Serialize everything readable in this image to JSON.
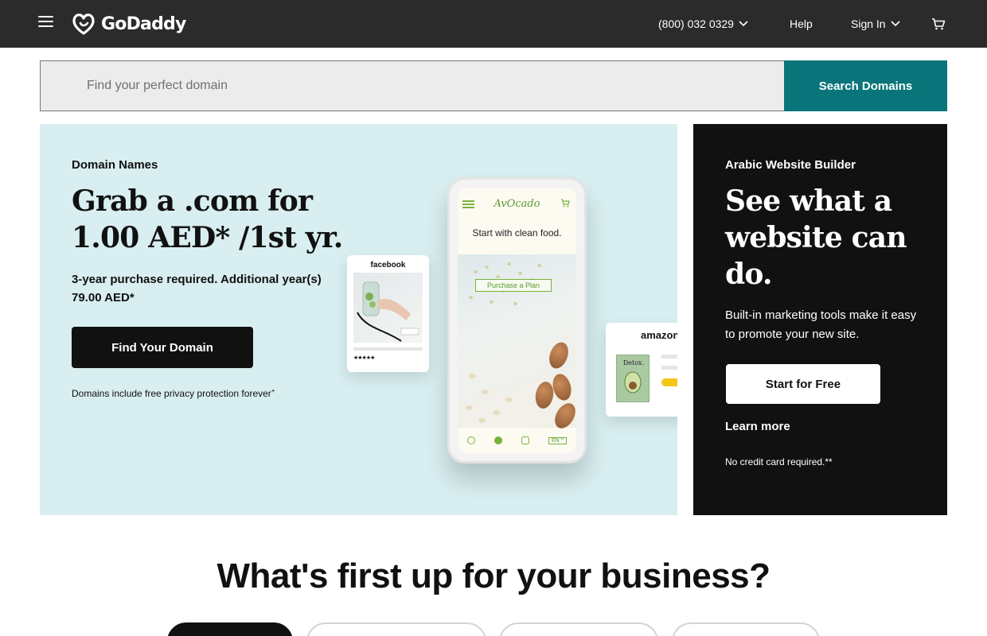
{
  "header": {
    "brand": "GoDaddy",
    "phone": "(800) 032 0329",
    "help": "Help",
    "sign_in": "Sign In"
  },
  "search": {
    "placeholder": "Find your perfect domain",
    "button": "Search Domains"
  },
  "hero": {
    "eyebrow": "Domain Names",
    "title": "Grab a .com for 1.00 AED* /1st yr.",
    "subtitle": "3-year purchase required. Additional year(s) 79.00 AED*",
    "button": "Find Your Domain",
    "note": "Domains include free privacy protection forever",
    "note_mark": "+",
    "mockup": {
      "facebook_label": "facebook",
      "phone_brand": "AvOcado",
      "phone_headline": "Start with clean food.",
      "phone_cta": "Purchase a Plan",
      "phone_lang": "EN ^",
      "amazon_label": "amazon",
      "book_title": "Detox."
    }
  },
  "promo": {
    "eyebrow": "Arabic Website Builder",
    "title": "See what a website can do.",
    "subtitle": "Built-in marketing tools make it easy to promote your new site.",
    "button": "Start for Free",
    "link": "Learn more",
    "note": "No credit card required.**"
  },
  "section": {
    "title": "What's first up for your business?"
  },
  "colors": {
    "topbar": "#2b2b2b",
    "search_button": "#09757a",
    "hero_bg": "#d8eef0",
    "promo_bg": "#111111",
    "accent_green": "#79b23b"
  },
  "icons": {
    "menu": "hamburger-icon",
    "logo": "godaddy-logo-icon",
    "phone_dropdown": "chevron-down-icon",
    "sign_in_dropdown": "chevron-down-icon",
    "cart": "cart-icon"
  }
}
